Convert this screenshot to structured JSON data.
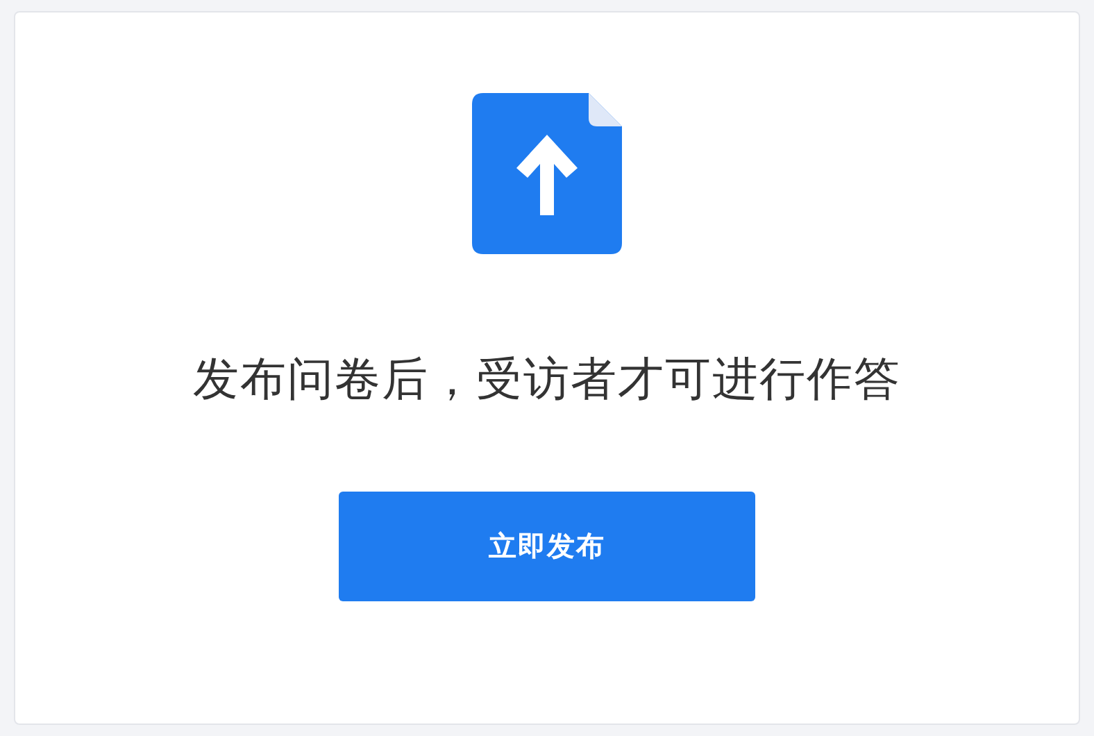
{
  "message": "发布问卷后，受访者才可进行作答",
  "button": {
    "label": "立即发布"
  }
}
